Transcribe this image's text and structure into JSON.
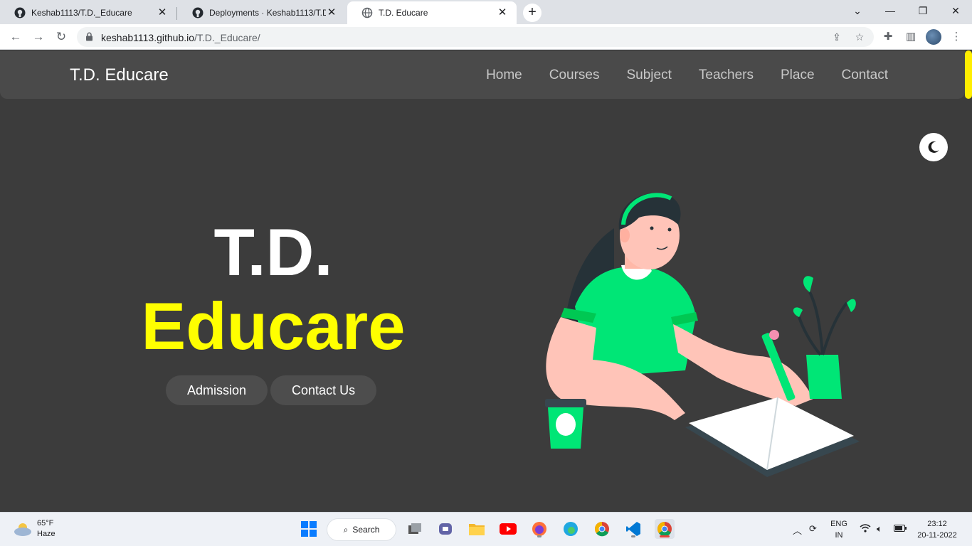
{
  "browser": {
    "tabs": [
      {
        "title": "Keshab1113/T.D._Educare",
        "icon": "github-icon"
      },
      {
        "title": "Deployments · Keshab1113/T.D._",
        "icon": "github-icon"
      },
      {
        "title": "T.D. Educare",
        "icon": "globe-icon"
      }
    ],
    "url_host": "keshab1113.github.io",
    "url_path": "/T.D._Educare/"
  },
  "site": {
    "brand": "T.D. Educare",
    "nav": [
      "Home",
      "Courses",
      "Subject",
      "Teachers",
      "Place",
      "Contact"
    ],
    "hero_line_1": "T.D.",
    "hero_line_2": "Educare",
    "buttons": {
      "admission": "Admission",
      "contact": "Contact Us"
    },
    "accent_color": "#ffff00",
    "background_color": "#3c3c3c",
    "illustration_color": "#00e676"
  },
  "taskbar": {
    "weather_temp": "65°F",
    "weather_desc": "Haze",
    "search_label": "Search",
    "language": "ENG",
    "region": "IN",
    "time": "23:12",
    "date": "20-11-2022"
  }
}
